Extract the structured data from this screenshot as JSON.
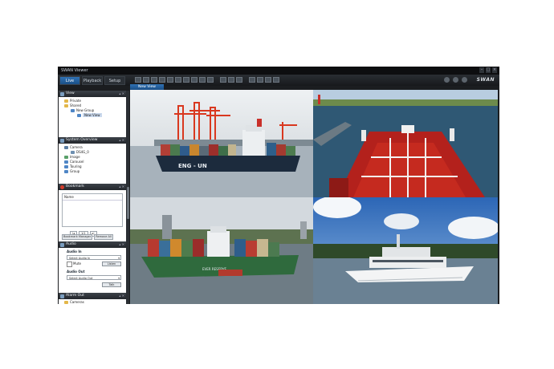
{
  "window": {
    "title": "SWAN Viewer",
    "brand": "SWAN"
  },
  "tabs": [
    {
      "label": "Live",
      "active": true
    },
    {
      "label": "Playback",
      "active": false
    },
    {
      "label": "Setup",
      "active": false
    }
  ],
  "view_tab": "New View",
  "panels": {
    "view": {
      "title": "View",
      "tree": [
        {
          "label": "Private",
          "depth": 1
        },
        {
          "label": "Shared",
          "depth": 1
        },
        {
          "label": "New Group",
          "depth": 2
        },
        {
          "label": "New View",
          "depth": 3,
          "selected": true
        }
      ]
    },
    "system_overview": {
      "title": "System Overview",
      "tree": [
        {
          "label": "Camera",
          "depth": 1
        },
        {
          "label": "DS4G_0",
          "depth": 2
        },
        {
          "label": "Image",
          "depth": 1
        },
        {
          "label": "Carousel",
          "depth": 1
        },
        {
          "label": "Touring",
          "depth": 1
        },
        {
          "label": "Group",
          "depth": 1
        }
      ]
    },
    "bookmark": {
      "title": "Bookmark",
      "column": "Name",
      "page_text": "1/1",
      "bookmark_manager": "Bookmark Manager",
      "remove_all": "Remove All"
    },
    "audio": {
      "title": "Audio",
      "audio_in_label": "Audio In",
      "audio_in_select": "Select Audio In",
      "mute_label": "Mute",
      "listen_button": "Listen",
      "audio_out_label": "Audio Out",
      "audio_out_select": "Select Audio Out",
      "talk_button": "Talk"
    },
    "alarm_out": {
      "title": "Alarm Out",
      "tree": [
        {
          "label": "Cameras",
          "depth": 1
        }
      ]
    }
  },
  "cameras": [
    {
      "scene": "container-ship-port",
      "hull_text": "ENG - UN"
    },
    {
      "scene": "tanker-deck"
    },
    {
      "scene": "container-ship-river",
      "hull_text": "EVER RESERVE"
    },
    {
      "scene": "yacht"
    }
  ],
  "colors": {
    "accent": "#2f72b5",
    "panel_header": "#2d3238",
    "background": "#1b1d20"
  }
}
